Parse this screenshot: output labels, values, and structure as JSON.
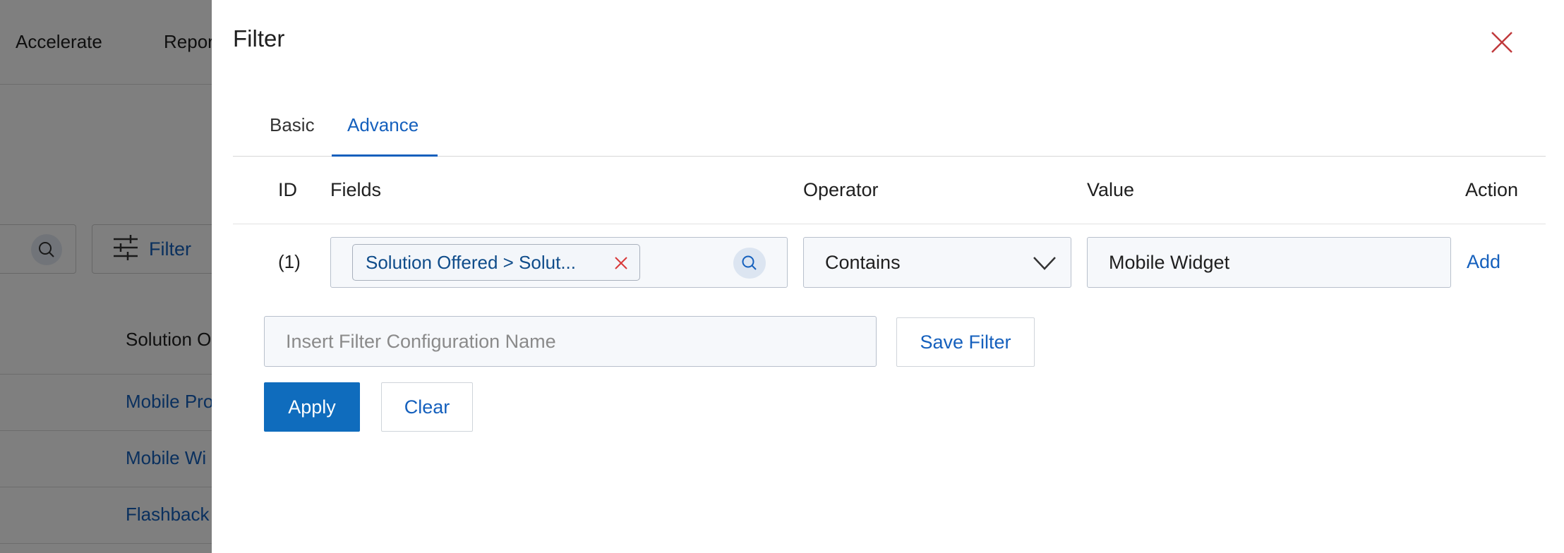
{
  "background": {
    "nav": {
      "items": [
        "Accelerate",
        "Repor"
      ]
    },
    "toolbar": {
      "filter_label": "Filter"
    },
    "table": {
      "column_header": "Solution O",
      "rows": [
        "Mobile Pro",
        "Mobile Wi",
        "Flashback"
      ]
    }
  },
  "drawer": {
    "title": "Filter",
    "tabs": [
      {
        "label": "Basic",
        "active": false
      },
      {
        "label": "Advance",
        "active": true
      }
    ],
    "table": {
      "headers": {
        "id": "ID",
        "fields": "Fields",
        "operator": "Operator",
        "value": "Value",
        "action": "Action"
      },
      "rows": [
        {
          "id": "(1)",
          "field_chip": "Solution Offered > Solut...",
          "operator": "Contains",
          "value": "Mobile Widget",
          "action": "Add"
        }
      ]
    },
    "config": {
      "placeholder": "Insert Filter Configuration Name",
      "value": ""
    },
    "buttons": {
      "save_filter": "Save Filter",
      "apply": "Apply",
      "clear": "Clear"
    }
  },
  "colors": {
    "accent": "#1560bd",
    "primary_button": "#0f6cbd",
    "close_icon": "#c0393b",
    "chip_remove_icon": "#d93a3a",
    "overlay": "rgba(0,0,0,0.5)"
  },
  "icons": {
    "close": "close-icon",
    "chip_remove": "close-icon",
    "fields_search": "search-icon",
    "operator_dropdown": "chevron-down-icon",
    "filter": "sliders-icon"
  }
}
